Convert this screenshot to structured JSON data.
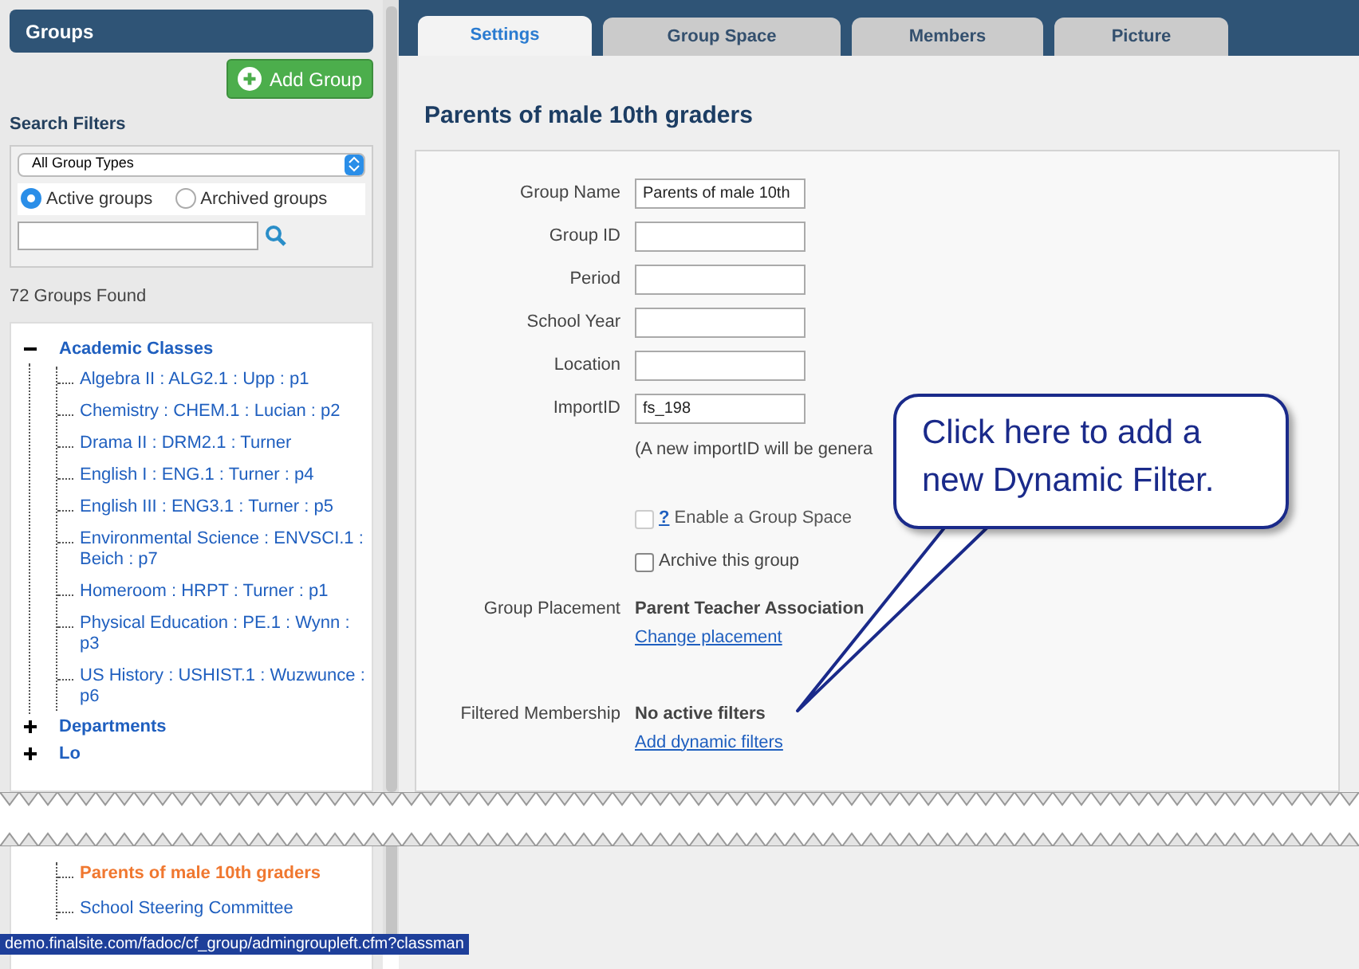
{
  "sidebar": {
    "title": "Groups",
    "add_button": "Add Group",
    "filters_heading": "Search Filters",
    "group_type": "All Group Types",
    "status_radios": [
      {
        "label": "Active groups",
        "selected": true
      },
      {
        "label": "Archived groups",
        "selected": false
      }
    ],
    "count": "72 Groups Found",
    "tree": [
      {
        "label": "Academic Classes",
        "expanded": true,
        "children": [
          {
            "label": "Algebra II : ALG2.1 : Upp : p1",
            "selected": false
          },
          {
            "label": "Chemistry : CHEM.1 : Lucian : p2",
            "selected": false
          },
          {
            "label": "Drama II : DRM2.1 : Turner",
            "selected": false
          },
          {
            "label": "English I : ENG.1 : Turner : p4",
            "selected": false
          },
          {
            "label": "English III : ENG3.1 : Turner : p5",
            "selected": false
          },
          {
            "label": "Environmental Science : ENVSCI.1 : Beich : p7",
            "selected": false
          },
          {
            "label": "Homeroom : HRPT : Turner : p1",
            "selected": false
          },
          {
            "label": "Physical Education : PE.1 : Wynn : p3",
            "selected": false
          },
          {
            "label": "US History : USHIST.1 : Wuzwunce : p6",
            "selected": false
          }
        ]
      },
      {
        "label": "Departments",
        "expanded": false
      },
      {
        "label": "Lo",
        "expanded": false
      }
    ],
    "tree_continued": [
      {
        "label": "Parents of male 10th graders",
        "selected": true
      },
      {
        "label": "School Steering Committee",
        "selected": false
      }
    ]
  },
  "tabs": [
    {
      "label": "Settings",
      "selected": true
    },
    {
      "label": "Group Space",
      "selected": false
    },
    {
      "label": "Members",
      "selected": false
    },
    {
      "label": "Picture",
      "selected": false
    }
  ],
  "page_title": "Parents of male 10th graders",
  "fields": [
    {
      "label": "Group Name",
      "value": "Parents of male 10th"
    },
    {
      "label": "Group ID"
    },
    {
      "label": "Period"
    },
    {
      "label": "School Year"
    },
    {
      "label": "Location"
    },
    {
      "label": "ImportID",
      "value": "fs_198"
    }
  ],
  "import_note": "(A new importID will be genera",
  "checkboxes": [
    {
      "help": "?",
      "label": "Enable a Group Space",
      "checked": false,
      "disabled": true
    },
    {
      "label": "Archive this group",
      "checked": false,
      "disabled": false
    }
  ],
  "details": [
    {
      "label": "Group Placement",
      "value": "Parent Teacher Association",
      "link": "Change placement"
    },
    {
      "label": "Filtered Membership",
      "value": "No active filters",
      "link": "Add dynamic filters"
    }
  ],
  "callout": "Click here to add a new Dynamic Filter.",
  "status_bar": "demo.finalsite.com/fadoc/cf_group/admingroupleft.cfm?classman"
}
